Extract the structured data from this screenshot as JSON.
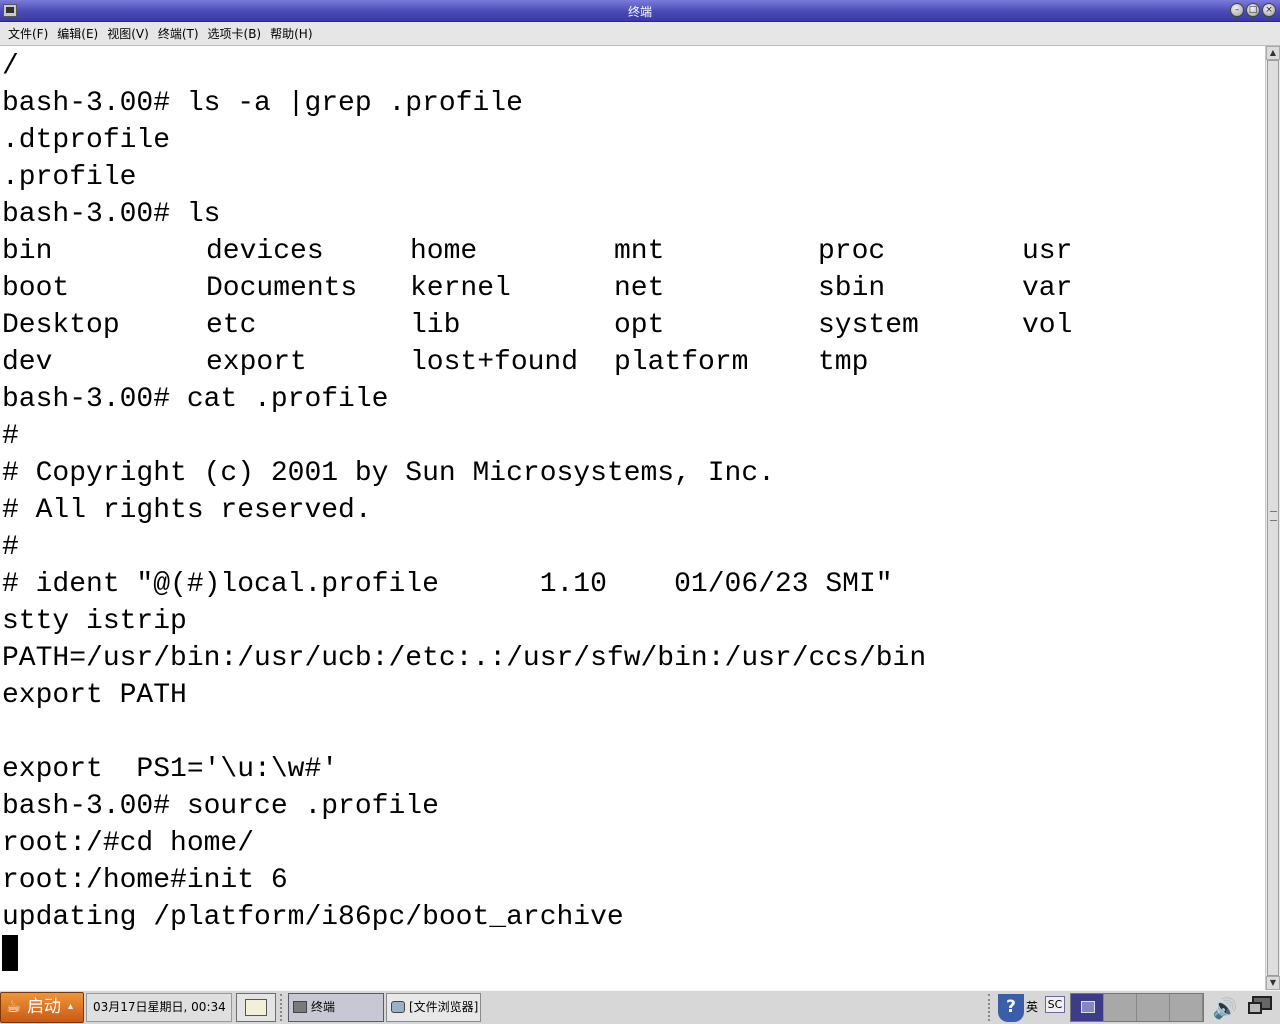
{
  "window": {
    "title": "终端",
    "buttons": {
      "minimize": "–",
      "maximize": "□",
      "close": "×"
    }
  },
  "menubar": {
    "items": [
      "文件(F)",
      "编辑(E)",
      "视图(V)",
      "终端(T)",
      "选项卡(B)",
      "帮助(H)"
    ]
  },
  "terminal": {
    "lines": [
      "/",
      "bash-3.00# ls -a |grep .profile",
      ".dtprofile",
      ".profile",
      "bash-3.00# ls",
      null,
      null,
      null,
      null,
      "bash-3.00# cat .profile",
      "#",
      "# Copyright (c) 2001 by Sun Microsystems, Inc.",
      "# All rights reserved.",
      "#",
      "# ident \"@(#)local.profile      1.10    01/06/23 SMI\"",
      "stty istrip",
      "PATH=/usr/bin:/usr/ucb:/etc:.:/usr/sfw/bin:/usr/ccs/bin",
      "export PATH",
      "",
      "export  PS1='\\u:\\w#'",
      "bash-3.00# source .profile",
      "root:/#cd home/",
      "root:/home#init 6",
      "updating /platform/i86pc/boot_archive"
    ],
    "ls_output": [
      [
        "bin",
        "devices",
        "home",
        "mnt",
        "proc",
        "usr"
      ],
      [
        "boot",
        "Documents",
        "kernel",
        "net",
        "sbin",
        "var"
      ],
      [
        "Desktop",
        "etc",
        "lib",
        "opt",
        "system",
        "vol"
      ],
      [
        "dev",
        "export",
        "lost+found",
        "platform",
        "tmp"
      ]
    ]
  },
  "taskbar": {
    "start_label": "启动",
    "start_arrow": "▴",
    "clock": "03月17日星期日, 00:34",
    "tasks": [
      "终端",
      "[文件浏览器]"
    ],
    "tray": {
      "help": "?",
      "lang": "英",
      "sc": "SC",
      "volume": "🔊"
    }
  },
  "colors": {
    "titlebar": "#4a4ab8",
    "terminal_bg": "#ffffff",
    "terminal_fg": "#000000",
    "start_button": "#e07a2a"
  }
}
